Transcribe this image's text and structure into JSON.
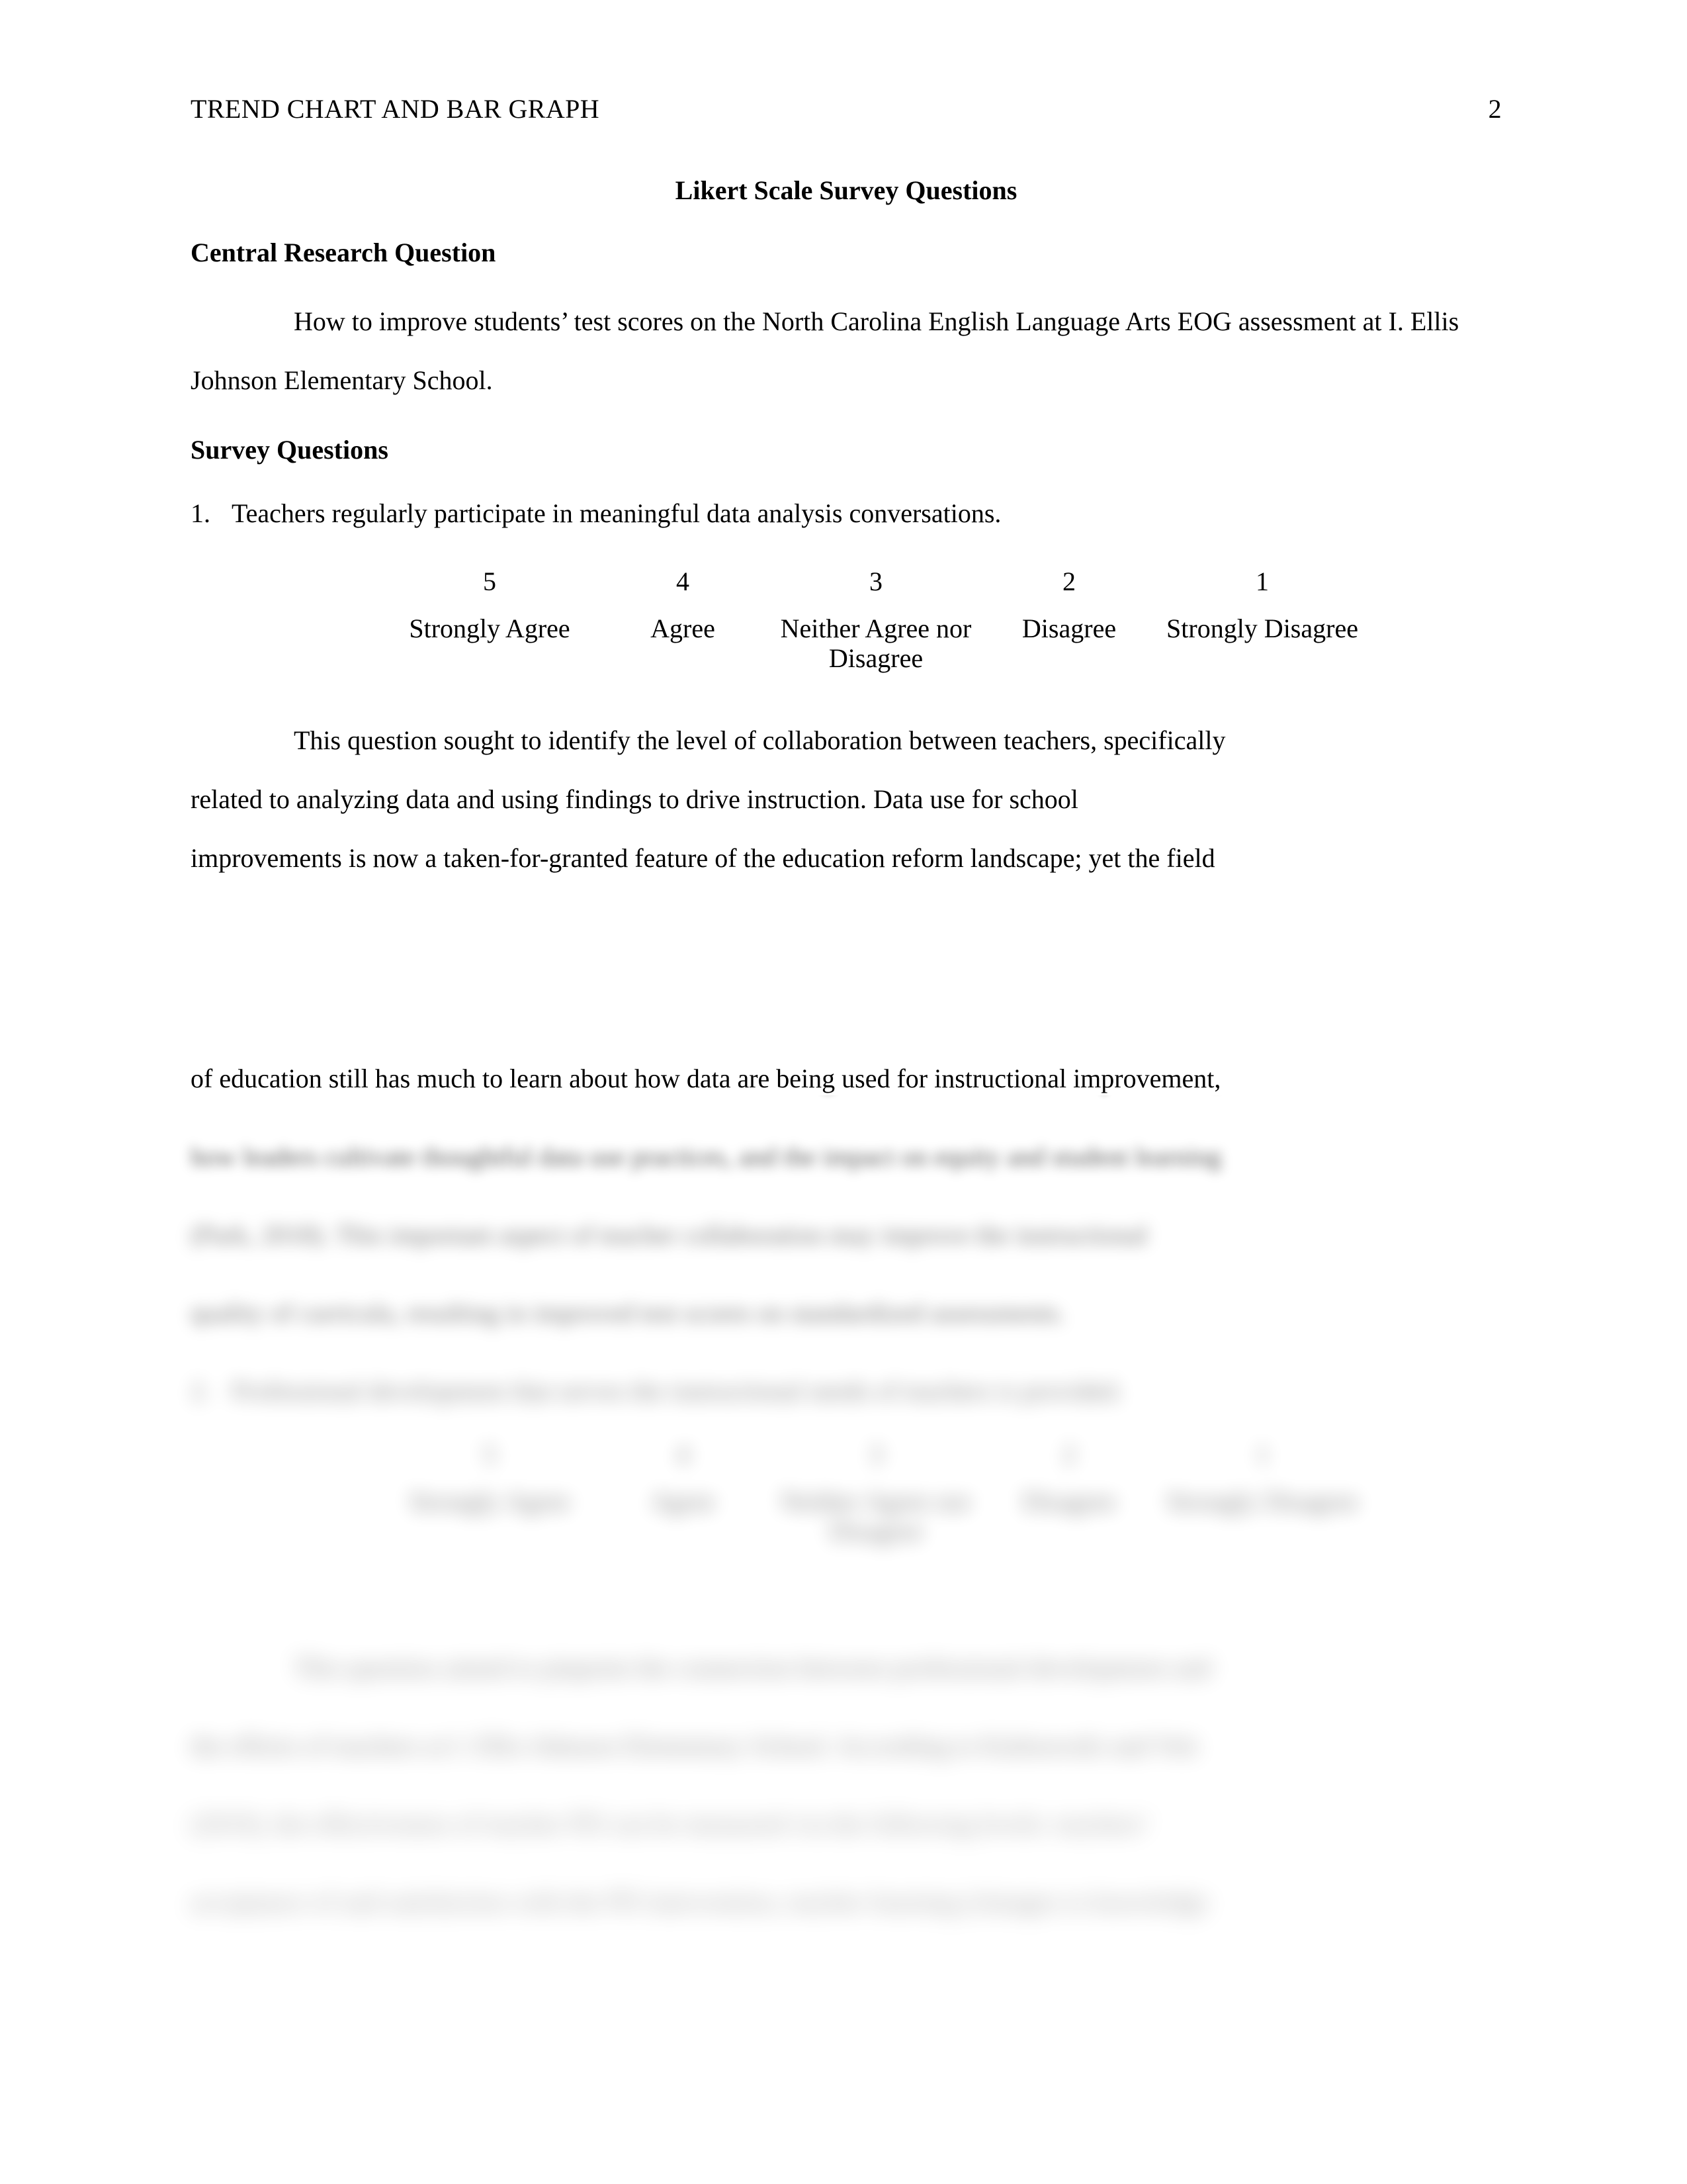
{
  "header": {
    "running_head": "TREND CHART AND BAR GRAPH",
    "page_number": "2"
  },
  "document": {
    "title": "Likert Scale Survey Questions",
    "heading_central_research_question": "Central Research Question",
    "central_research_question_text": "How to improve students’ test scores on the North Carolina English Language Arts EOG assessment at I. Ellis Johnson Elementary School.",
    "heading_survey_questions": "Survey Questions"
  },
  "likert_scale": {
    "columns": [
      {
        "number": "5",
        "label": "Strongly Agree"
      },
      {
        "number": "4",
        "label": "Agree"
      },
      {
        "number": "3",
        "label": "Neither Agree nor Disagree"
      },
      {
        "number": "2",
        "label": "Disagree"
      },
      {
        "number": "1",
        "label": "Strongly Disagree"
      }
    ]
  },
  "questions": [
    {
      "number": "1.",
      "text": "Teachers regularly participate in meaningful data analysis conversations.",
      "commentary": "This question sought to identify the level of collaboration between teachers, specifically related to analyzing data and using findings to drive instruction. Data use for school improvements is now a taken-for-granted feature of the education reform landscape; yet the field of education still has much to learn about how data are being used for instructional improvement, how leaders cultivate thoughtful data use practices, and the impact on equity and student learning (Park, 2018). This important aspect of teacher collaboration may improve the instructional quality of curricula, resulting in improved test scores on standardized assessments."
    },
    {
      "number": "2.",
      "text": "Professional development that serves the instructional needs of teachers is provided.",
      "commentary": "This question aimed to pinpoint the connection between professional development and the efforts of teachers at I. Ellis Johnson Elementary School. According to Kalinowski and Veit (2019), the effectiveness of teacher PD can be measured via the following levels: teachers’ acceptance of and satisfaction with the PD intervention, teacher learning (changes to knowledge"
    }
  ],
  "commentary_lines": {
    "q1": [
      "This question sought to identify the level of collaboration between teachers, specifically",
      "related to analyzing data and using findings to drive instruction. Data use for school",
      "improvements is now a taken-for-granted feature of the education reform landscape; yet the field",
      "of education still has much to learn about how data are being used for instructional improvement,",
      "how leaders cultivate thoughtful data use practices, and the impact on equity and student learning",
      "(Park, 2018). This important aspect of teacher collaboration may improve the instructional",
      "quality of curricula, resulting in improved test scores on standardized assessments."
    ],
    "q2": [
      "This question aimed to pinpoint the connection between professional development and",
      "the efforts of teachers at I. Ellis Johnson Elementary School. According to Kalinowski and Veit",
      "(2019), the effectiveness of teacher PD can be measured via the following levels: teachers’",
      "acceptance of and satisfaction with the PD intervention, teacher learning (changes to knowledge"
    ]
  }
}
